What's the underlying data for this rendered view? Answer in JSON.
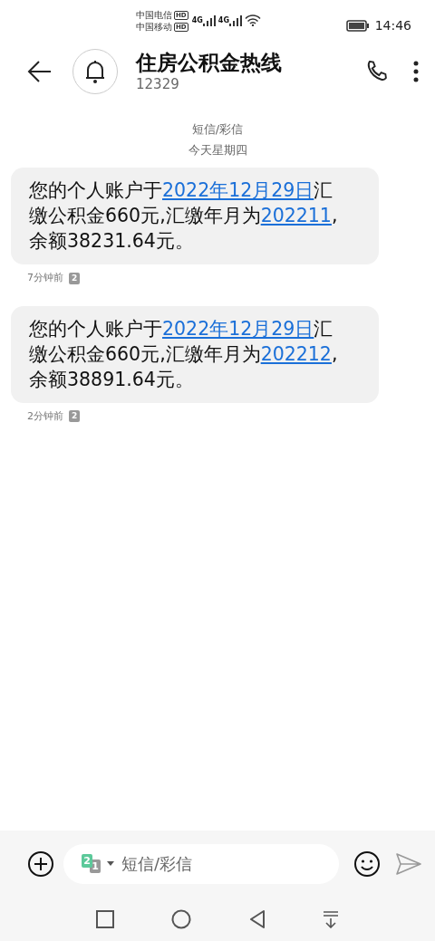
{
  "status_bar": {
    "carriers": [
      {
        "name": "中国电信",
        "badge": "HD",
        "network": "4G"
      },
      {
        "name": "中国移动",
        "badge": "HD",
        "network": "4G"
      }
    ],
    "time": "14:46"
  },
  "header": {
    "title": "住房公积金热线",
    "number": "12329"
  },
  "thread_info": {
    "type": "短信/彩信",
    "day": "今天星期四"
  },
  "messages": [
    {
      "segments": [
        {
          "kind": "text",
          "text": "您的个人账户于"
        },
        {
          "kind": "link",
          "text": "2022年12月29日"
        },
        {
          "kind": "text",
          "text": "汇缴公积金660元,汇缴年月为"
        },
        {
          "kind": "link",
          "text": "202211"
        },
        {
          "kind": "text",
          "text": ", 余额38231.64元。"
        }
      ],
      "time": "7分钟前",
      "sim": "2"
    },
    {
      "segments": [
        {
          "kind": "text",
          "text": "您的个人账户于"
        },
        {
          "kind": "link",
          "text": "2022年12月29日"
        },
        {
          "kind": "text",
          "text": "汇缴公积金660元,汇缴年月为"
        },
        {
          "kind": "link",
          "text": "202212"
        },
        {
          "kind": "text",
          "text": ", 余额38891.64元。"
        }
      ],
      "time": "2分钟前",
      "sim": "2"
    }
  ],
  "composer": {
    "sim_front": "2",
    "sim_back": "1",
    "placeholder": "短信/彩信"
  }
}
